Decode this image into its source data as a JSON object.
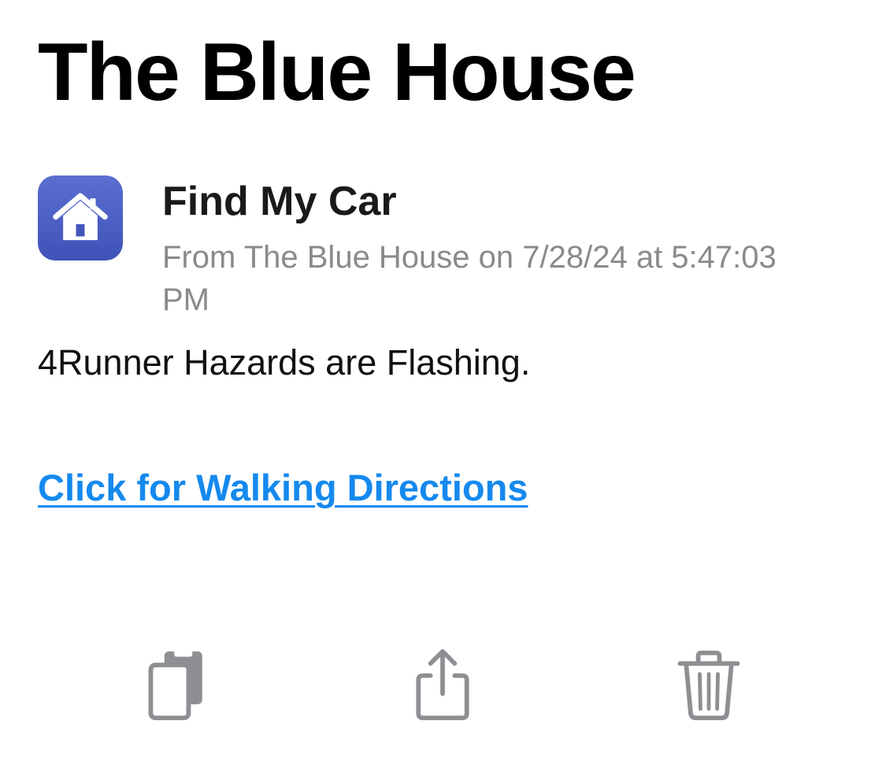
{
  "page": {
    "title": "The Blue House"
  },
  "notification": {
    "app_icon": "home-icon",
    "title": "Find My Car",
    "meta": "From The Blue House on 7/28/24 at 5:47:03 PM",
    "message": "4Runner Hazards are Flashing.",
    "link_text": "Click for Walking Directions"
  },
  "toolbar": {
    "items": [
      {
        "icon": "copy-icon"
      },
      {
        "icon": "share-icon"
      },
      {
        "icon": "trash-icon"
      }
    ]
  },
  "colors": {
    "accent_link": "#1589ee",
    "icon_gradient_top": "#5b6fd0",
    "icon_gradient_bottom": "#3f52b8",
    "secondary_text": "#8a8a8e",
    "toolbar_icon": "#8e8e93"
  }
}
